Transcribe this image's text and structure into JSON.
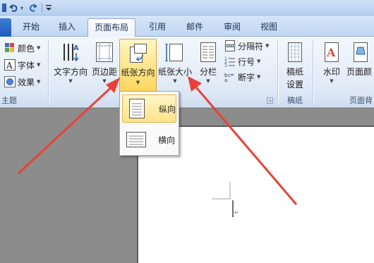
{
  "quick_access": {
    "undo_icon": "undo-icon",
    "redo_icon": "redo-icon",
    "customize_icon": "customize-qat-icon"
  },
  "tabs": [
    {
      "label": "开始"
    },
    {
      "label": "插入"
    },
    {
      "label": "页面布局",
      "active": true
    },
    {
      "label": "引用"
    },
    {
      "label": "邮件"
    },
    {
      "label": "审阅"
    },
    {
      "label": "视图"
    }
  ],
  "themes_group": {
    "colors_label": "颜色",
    "fonts_label": "字体",
    "effects_label": "效果",
    "group_label": "主题"
  },
  "page_setup_group": {
    "text_direction_label": "文字方向",
    "margins_label": "页边距",
    "orientation_label": "纸张方向",
    "size_label": "纸张大小",
    "columns_label": "分栏",
    "breaks_label": "分隔符",
    "line_numbers_label": "行号",
    "hyphenation_label": "断字"
  },
  "manuscript_group": {
    "button_label_1": "稿纸",
    "button_label_2": "设置",
    "group_label": "稿纸"
  },
  "page_background_group": {
    "watermark_label": "水印",
    "page_color_label": "页面颜",
    "group_label": "页面背"
  },
  "orientation_menu": {
    "items": [
      {
        "label": "纵向",
        "selected": true
      },
      {
        "label": "横向",
        "selected": false
      }
    ]
  },
  "colors": {
    "accent_highlight": "#ffd65c",
    "arrow": "#e8413a",
    "file_tab": "#1e5bb8"
  }
}
